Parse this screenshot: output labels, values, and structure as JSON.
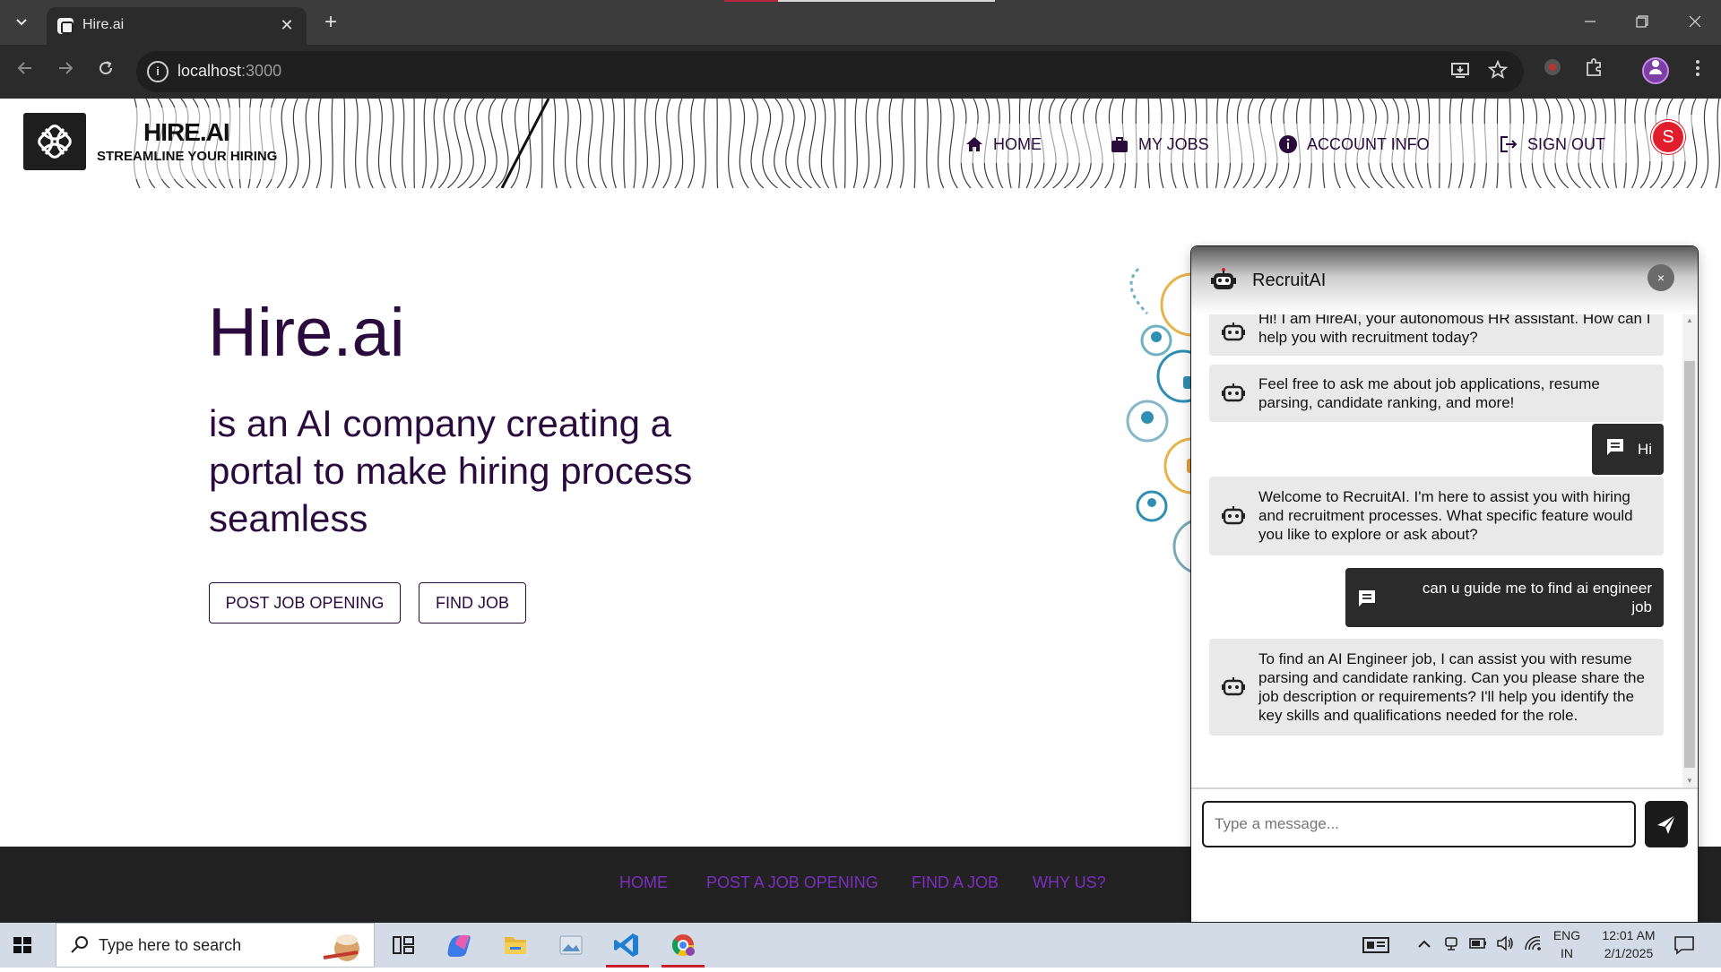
{
  "browser": {
    "tab_title": "Hire.ai",
    "url_host": "localhost",
    "url_port": ":3000",
    "tab_close_glyph": "✕",
    "new_tab_glyph": "+",
    "icons": [
      "tab-dropdown-icon",
      "back-icon",
      "forward-icon",
      "reload-icon",
      "site-info-icon",
      "install-app-icon",
      "bookmark-star-icon",
      "extension-icon",
      "puzzle-icon",
      "profile-icon",
      "kebab-menu-icon"
    ]
  },
  "header": {
    "brand_name": "HIRE.AI",
    "tagline": "STREAMLINE YOUR HIRING",
    "nav": [
      {
        "label": "HOME",
        "icon": "home-icon"
      },
      {
        "label": "MY JOBS",
        "icon": "briefcase-icon"
      },
      {
        "label": "ACCOUNT INFO",
        "icon": "info-icon"
      },
      {
        "label": "SIGN OUT",
        "icon": "sign-out-icon"
      }
    ],
    "avatar_letter": "S",
    "avatar_color": "#e11d2b"
  },
  "hero": {
    "title": "Hire.ai",
    "subtitle": "is an AI company creating a portal to make hiring process seamless",
    "buttons": [
      "POST JOB OPENING",
      "FIND JOB"
    ],
    "text_color": "#2b0a3d"
  },
  "footer": {
    "links": [
      "HOME",
      "POST A JOB OPENING",
      "FIND A JOB",
      "WHY US?"
    ],
    "link_color": "#7b2fbf"
  },
  "chat": {
    "title": "RecruitAI",
    "close_glyph": "×",
    "messages": [
      {
        "from": "bot",
        "text": "Hi! I am HireAI, your autonomous HR assistant. How can I help you with recruitment today?"
      },
      {
        "from": "bot",
        "text": "Feel free to ask me about job applications, resume parsing, candidate ranking, and more!"
      },
      {
        "from": "user",
        "text": "Hi"
      },
      {
        "from": "bot",
        "text": "Welcome to RecruitAI. I'm here to assist you with hiring and recruitment processes. What specific feature would you like to explore or ask about?"
      },
      {
        "from": "user",
        "text": "can u guide me to find ai engineer job"
      },
      {
        "from": "bot",
        "text": "To find an AI Engineer job, I can assist you with resume parsing and candidate ranking. Can you please share the job description or requirements? I'll help you identify the key skills and qualifications needed for the role."
      }
    ],
    "input_placeholder": "Type a message...",
    "input_value": ""
  },
  "taskbar": {
    "search_placeholder": "Type here to search",
    "language": "ENG",
    "region": "IN",
    "time": "12:01 AM",
    "date": "2/1/2025",
    "apps": [
      "task-view-icon",
      "copilot-icon",
      "file-explorer-icon",
      "photos-icon",
      "vscode-icon",
      "chrome-icon"
    ],
    "tray": [
      "news-widget-icon",
      "chevron-up-icon",
      "meet-now-icon",
      "battery-icon",
      "volume-icon",
      "wifi-icon",
      "notification-icon"
    ]
  }
}
